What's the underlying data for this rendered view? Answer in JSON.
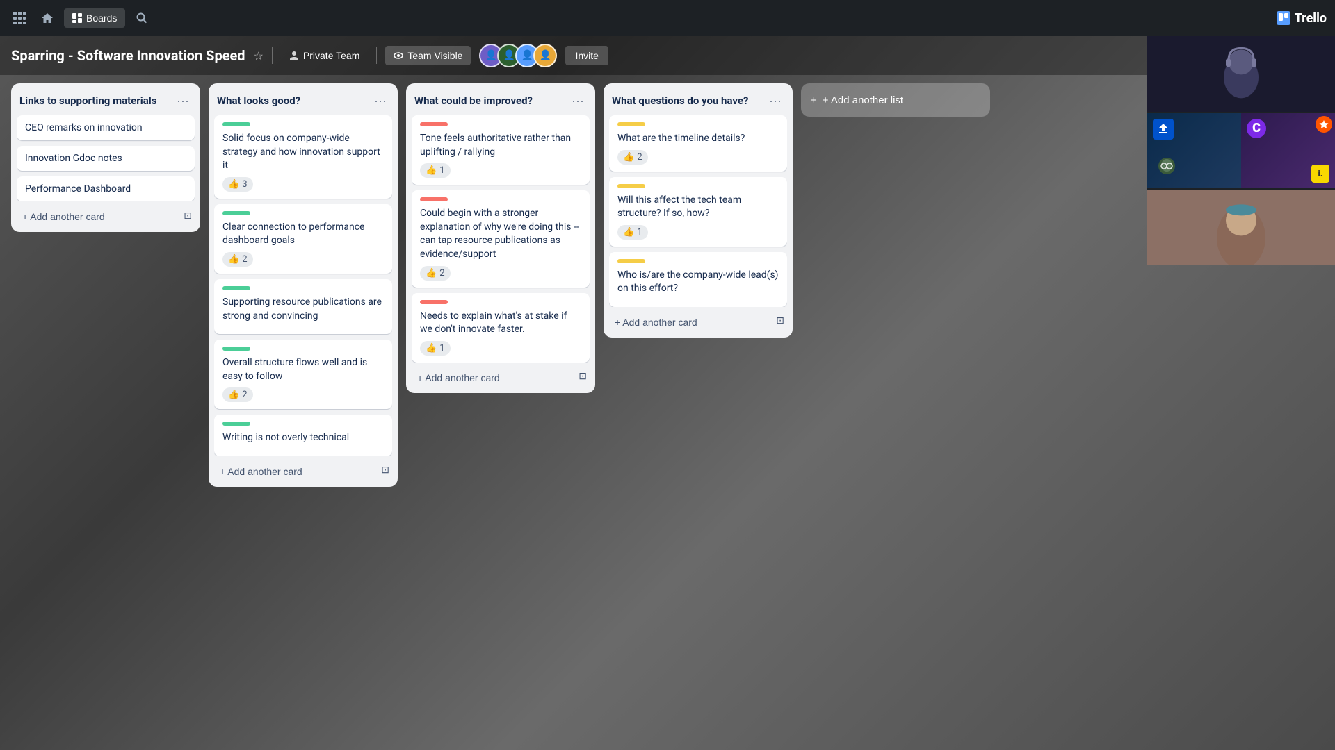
{
  "topbar": {
    "boards_label": "Boards",
    "trello_label": "Trello"
  },
  "board_header": {
    "title": "Sparring - Software Innovation Speed",
    "private_team_label": "Private Team",
    "team_visible_label": "Team Visible",
    "invite_label": "Invite"
  },
  "lists": [
    {
      "id": "links",
      "title": "Links to supporting materials",
      "cards": [
        {
          "text": "CEO remarks on innovation",
          "type": "simple"
        },
        {
          "text": "Innovation Gdoc notes",
          "type": "simple"
        },
        {
          "text": "Performance Dashboard",
          "type": "simple"
        }
      ],
      "add_card_label": "+ Add another card"
    },
    {
      "id": "looks_good",
      "title": "What looks good?",
      "cards": [
        {
          "label_color": "green",
          "text": "Solid focus on company-wide strategy and how innovation support it",
          "votes": 3
        },
        {
          "label_color": "green",
          "text": "Clear connection to performance dashboard goals",
          "votes": 2
        },
        {
          "label_color": "green",
          "text": "Supporting resource publications are strong and convincing",
          "votes": null
        },
        {
          "label_color": "green",
          "text": "Overall structure flows well and is easy to follow",
          "votes": 2
        },
        {
          "label_color": "green",
          "text": "Writing is not overly technical",
          "votes": null
        }
      ],
      "add_card_label": "+ Add another card"
    },
    {
      "id": "could_improve",
      "title": "What could be improved?",
      "cards": [
        {
          "label_color": "red",
          "text": "Tone feels authoritative rather than uplifting / rallying",
          "votes": 1
        },
        {
          "label_color": "red",
          "text": "Could begin with a stronger explanation of why we're doing this -- can tap resource publications as evidence/support",
          "votes": 2
        },
        {
          "label_color": "red",
          "text": "Needs to explain what's at stake if we don't innovate faster.",
          "votes": 1
        }
      ],
      "add_card_label": "+ Add another card"
    },
    {
      "id": "questions",
      "title": "What questions do you have?",
      "cards": [
        {
          "label_color": "yellow",
          "text": "What are the timeline details?",
          "votes": 2
        },
        {
          "label_color": "yellow",
          "text": "Will this affect the tech team structure? If so, how?",
          "votes": 1
        },
        {
          "label_color": "yellow",
          "text": "Who is/are the company-wide lead(s) on this effort?",
          "votes": null
        }
      ],
      "add_card_label": "+ Add another card"
    }
  ],
  "add_list_label": "+ Add another list",
  "icons": {
    "grid": "⊞",
    "home": "⌂",
    "search": "🔍",
    "boards": "▦",
    "star": "☆",
    "lock": "🔒",
    "eye": "👁",
    "people": "👥",
    "thumbsup": "👍",
    "plus": "+",
    "ellipsis": "•••",
    "print": "⊡"
  }
}
